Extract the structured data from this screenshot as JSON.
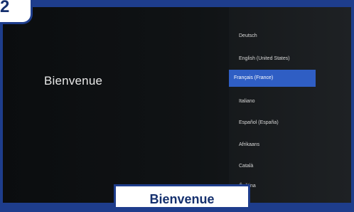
{
  "step_number": "2",
  "welcome_text": "Bienvenue",
  "languages": [
    {
      "label": "Deutsch",
      "selected": false
    },
    {
      "label": "English (United States)",
      "selected": false
    },
    {
      "label": "Français (France)",
      "selected": true
    },
    {
      "label": "Italiano",
      "selected": false
    },
    {
      "label": "Español (España)",
      "selected": false
    },
    {
      "label": "Afrikaans",
      "selected": false
    },
    {
      "label": "Català",
      "selected": false
    },
    {
      "label": "Čeština",
      "selected": false
    }
  ],
  "caption": "Bienvenue",
  "colors": {
    "frame": "#1e3d8c",
    "selection": "#2f5ec4",
    "background": "#0b0d0f"
  }
}
